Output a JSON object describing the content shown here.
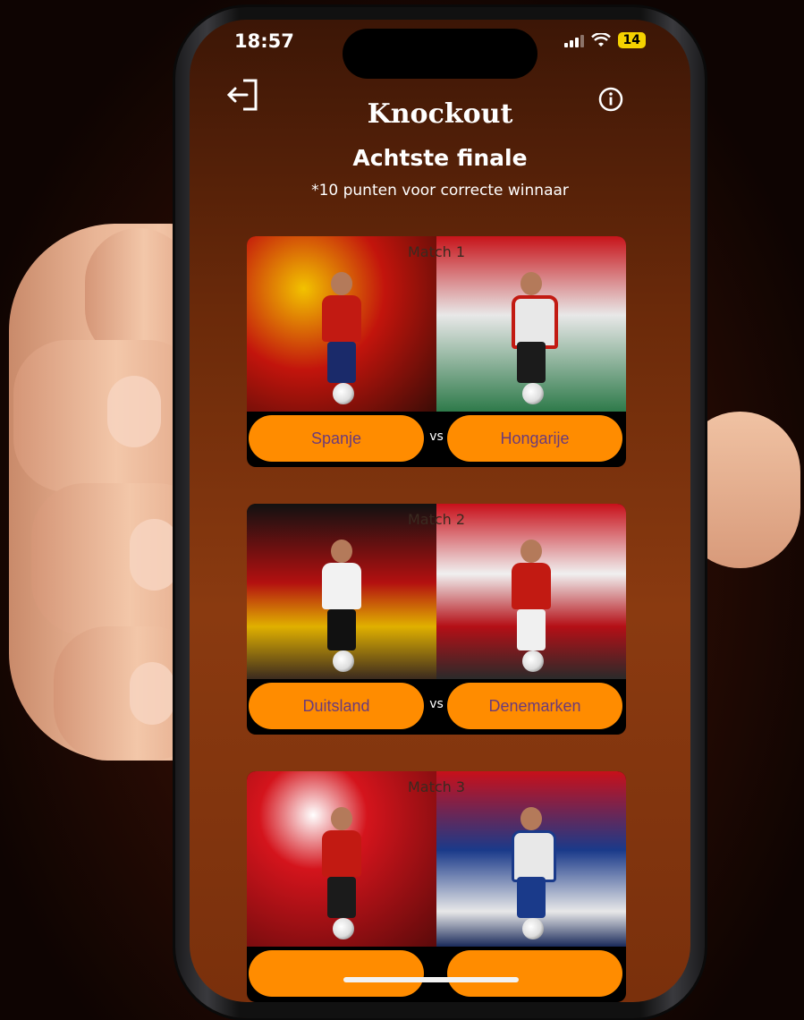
{
  "status_bar": {
    "time": "18:57",
    "battery": "14"
  },
  "header": {
    "title": "Knockout"
  },
  "round": {
    "title": "Achtste finale",
    "note": "*10 punten voor correcte winnaar"
  },
  "matches": [
    {
      "label": "Match 1",
      "home": "Spanje",
      "away": "Hongarije",
      "vs": "vs"
    },
    {
      "label": "Match 2",
      "home": "Duitsland",
      "away": "Denemarken",
      "vs": "vs"
    },
    {
      "label": "Match 3",
      "home": "",
      "away": "",
      "vs": ""
    }
  ],
  "colors": {
    "accent": "#ff8c00",
    "button_text": "#6b3b7a",
    "background": "#6b2a0a"
  },
  "icons": {
    "exit": "exit-icon",
    "info": "info-icon"
  }
}
